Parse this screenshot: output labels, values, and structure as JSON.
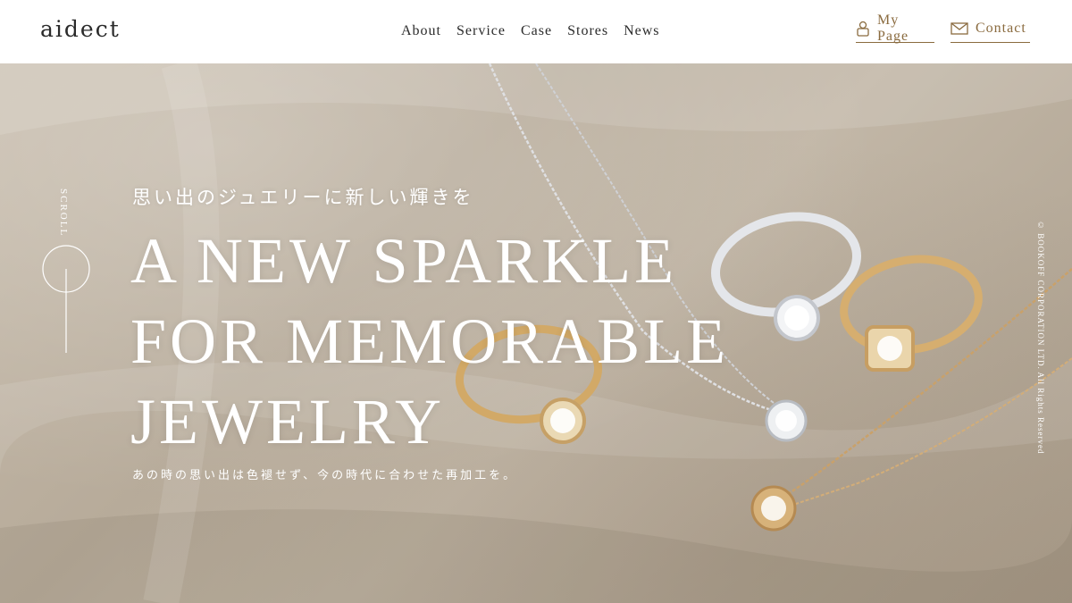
{
  "header": {
    "logo": "aidect",
    "nav": [
      "About",
      "Service",
      "Case",
      "Stores",
      "News"
    ],
    "my_page_label": "My Page",
    "contact_label": "Contact",
    "accent_color": "#8a6b3f"
  },
  "hero": {
    "scroll_label": "SCROLL",
    "subtitle_jp": "思い出のジュエリーに新しい輝きを",
    "headline": [
      "A NEW SPARKLE",
      "FOR MEMORABLE",
      "JEWELRY"
    ],
    "tagline": "あの時の思い出は色褪せず、今の時代に合わせた再加工を。",
    "copyright": "© BOOKOFF CORPORATION LTD. All Rights Reserved"
  }
}
